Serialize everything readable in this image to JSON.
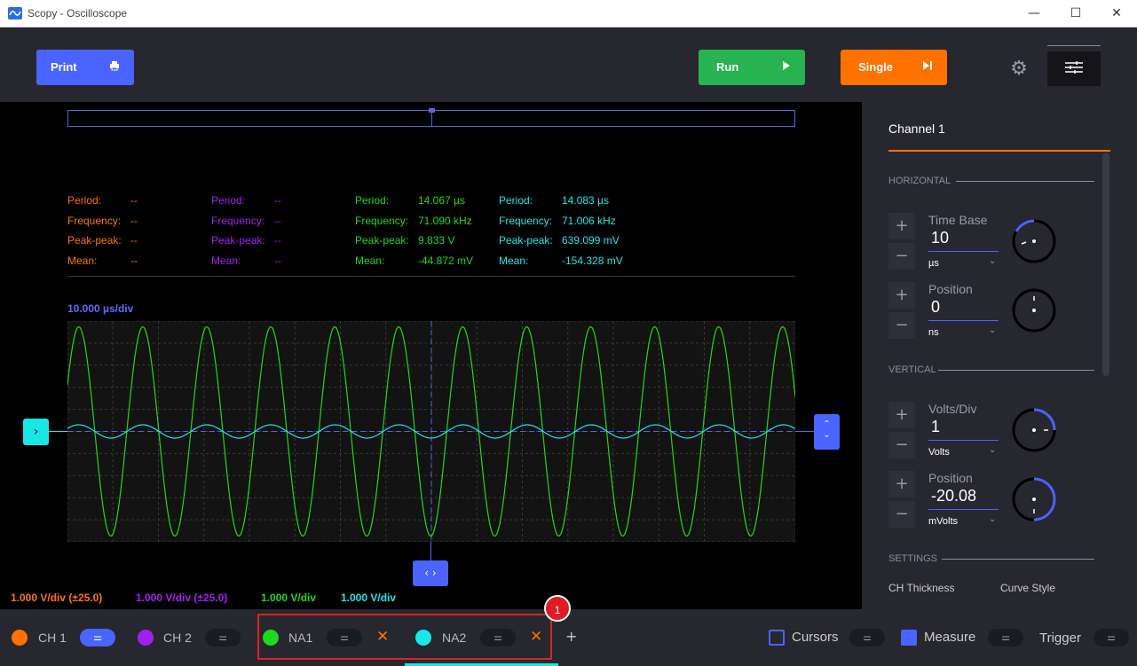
{
  "window": {
    "title": "Scopy - Oscilloscope",
    "minimize": "—",
    "maximize": "☐",
    "close": "✕"
  },
  "toolbar": {
    "print_label": "Print",
    "run_label": "Run",
    "single_label": "Single"
  },
  "measurements": [
    {
      "color": "#ff7200",
      "period": "--",
      "frequency": "--",
      "peak_peak": "--",
      "mean": "--"
    },
    {
      "color": "#a020f0",
      "period": "--",
      "frequency": "--",
      "peak_peak": "--",
      "mean": "--"
    },
    {
      "color": "#1fd81f",
      "period": "14.067 µs",
      "frequency": "71.090 kHz",
      "peak_peak": "9.833 V",
      "mean": "-44.872 mV"
    },
    {
      "color": "#19e7e7",
      "period": "14.083 µs",
      "frequency": "71.006 kHz",
      "peak_peak": "639.099 mV",
      "mean": "-154.328 mV"
    }
  ],
  "meas_labels": {
    "period": "Period:",
    "frequency": "Frequency:",
    "peak_peak": "Peak-peak:",
    "mean": "Mean:"
  },
  "time_div": "10.000 µs/div",
  "volt_divs": [
    {
      "text": "1.000 V/div (±25.0)",
      "color": "#ff7200"
    },
    {
      "text": "1.000 V/div (±25.0)",
      "color": "#a020f0"
    },
    {
      "text": "1.000 V/div",
      "color": "#1fd81f"
    },
    {
      "text": "1.000 V/div",
      "color": "#19e7e7"
    }
  ],
  "panel": {
    "title": "Channel 1",
    "horizontal": "HORIZONTAL",
    "vertical": "VERTICAL",
    "settings": "SETTINGS",
    "time_base": {
      "label": "Time Base",
      "value": "10",
      "unit": "µs"
    },
    "h_position": {
      "label": "Position",
      "value": "0",
      "unit": "ns"
    },
    "volts_div": {
      "label": "Volts/Div",
      "value": "1",
      "unit": "Volts"
    },
    "v_position": {
      "label": "Position",
      "value": "-20.08",
      "unit": "mVolts"
    },
    "ch_thickness": "CH Thickness",
    "curve_style": "Curve Style"
  },
  "channels": [
    {
      "label": "CH 1",
      "color": "#ff7200"
    },
    {
      "label": "CH 2",
      "color": "#a020f0"
    },
    {
      "label": "NA1",
      "color": "#1fd81f"
    },
    {
      "label": "NA2",
      "color": "#19e7e7"
    }
  ],
  "add_channel": "+",
  "badge": "1",
  "tools": {
    "cursors": "Cursors",
    "measure": "Measure",
    "trigger": "Trigger"
  }
}
